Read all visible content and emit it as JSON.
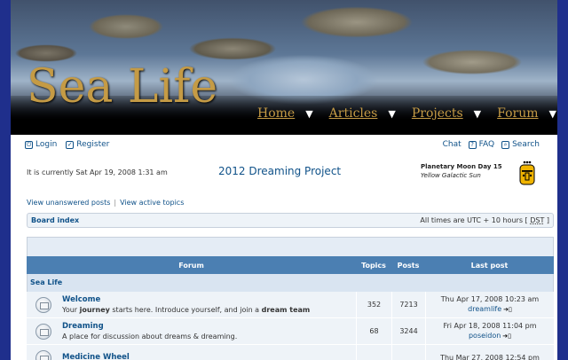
{
  "site": {
    "title": "Sea Life"
  },
  "nav": [
    {
      "label": "Home"
    },
    {
      "label": "Articles"
    },
    {
      "label": "Projects"
    },
    {
      "label": "Forum"
    }
  ],
  "topbar": {
    "login": "Login",
    "register": "Register",
    "chat": "Chat",
    "faq": "FAQ",
    "search": "Search"
  },
  "info": {
    "current_time": "It is currently Sat Apr 19, 2008 1:31 am",
    "project": "2012 Dreaming Project",
    "moon_title": "Planetary Moon Day 15",
    "moon_sub": "Yellow Galactic Sun"
  },
  "quick_links": {
    "unanswered": "View unanswered posts",
    "separator": "|",
    "active": "View active topics"
  },
  "breadcrumb": {
    "board_index": "Board index",
    "timezone_prefix": "All times are UTC + 10 hours [",
    "dst": "DST",
    "timezone_suffix": "]"
  },
  "table": {
    "headers": {
      "forum": "Forum",
      "topics": "Topics",
      "posts": "Posts",
      "last_post": "Last post"
    },
    "category": "Sea Life",
    "rows": [
      {
        "name": "Welcome",
        "desc_parts": [
          "Your ",
          "journey",
          " starts here. Introduce yourself, and join a ",
          "dream team"
        ],
        "topics": "352",
        "posts": "7213",
        "last_date": "Thu Apr 17, 2008 10:23 am",
        "last_by": "dreamlife"
      },
      {
        "name": "Dreaming",
        "desc": "A place for discussion about dreams & dreaming.",
        "topics": "68",
        "posts": "3244",
        "last_date": "Fri Apr 18, 2008 11:04 pm",
        "last_by": "poseidon"
      },
      {
        "name": "Medicine Wheel",
        "desc": "",
        "topics": "",
        "posts": "",
        "last_date": "Thu Mar 27, 2008 12:54 pm",
        "last_by": ""
      }
    ]
  },
  "colors": {
    "accent": "#105289",
    "header_bar": "#4b7fb2",
    "logo": "#c59b45",
    "background": "#1f2f8c"
  }
}
